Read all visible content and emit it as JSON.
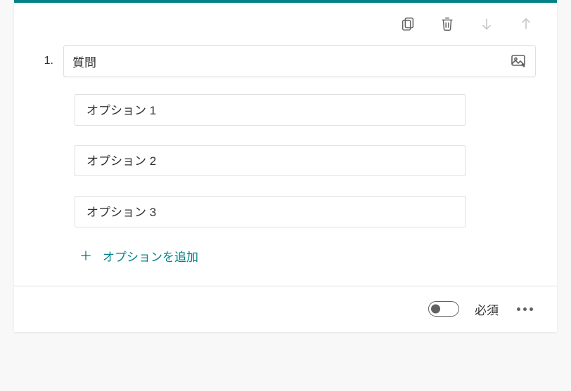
{
  "question": {
    "number": "1.",
    "title": "質問",
    "options": [
      {
        "label": "オプション 1"
      },
      {
        "label": "オプション 2"
      },
      {
        "label": "オプション 3"
      }
    ],
    "addOptionLabel": "オプションを追加"
  },
  "footer": {
    "requiredLabel": "必須",
    "requiredOn": false
  }
}
